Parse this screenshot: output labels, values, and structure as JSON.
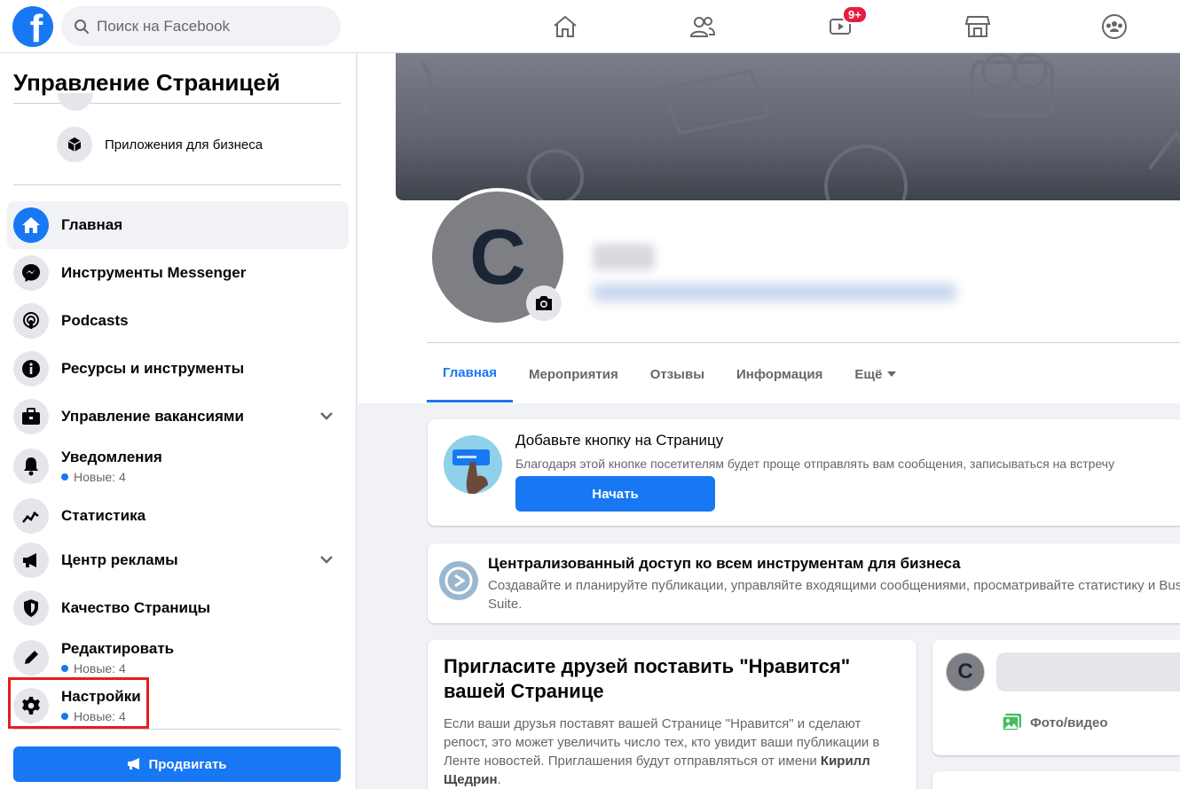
{
  "topbar": {
    "logo_letter": "f",
    "search_placeholder": "Поиск на Facebook",
    "nav": [
      {
        "name": "home-icon"
      },
      {
        "name": "friends-icon"
      },
      {
        "name": "watch-icon",
        "badge": "9+"
      },
      {
        "name": "marketplace-icon"
      },
      {
        "name": "groups-icon"
      }
    ]
  },
  "sidebar": {
    "title": "Управление Страницей",
    "apps_label": "Приложения для бизнеса",
    "items": [
      {
        "label": "Главная",
        "icon": "home-icon"
      },
      {
        "label": "Инструменты Messenger",
        "icon": "messenger-icon"
      },
      {
        "label": "Podcasts",
        "icon": "podcasts-icon"
      },
      {
        "label": "Ресурсы и инструменты",
        "icon": "info-icon"
      },
      {
        "label": "Управление вакансиями",
        "icon": "briefcase-icon"
      },
      {
        "label": "Уведомления",
        "icon": "bell-icon",
        "new": "Новые: 4"
      },
      {
        "label": "Статистика",
        "icon": "chart-icon"
      },
      {
        "label": "Центр рекламы",
        "icon": "megaphone-icon"
      },
      {
        "label": "Качество Страницы",
        "icon": "shield-icon"
      },
      {
        "label": "Редактировать",
        "icon": "pencil-icon",
        "new": "Новые: 4"
      },
      {
        "label": "Настройки",
        "icon": "gear-icon",
        "new": "Новые: 4"
      }
    ],
    "promote_label": "Продвигать"
  },
  "profile": {
    "avatar_letter": "C",
    "tabs": [
      "Главная",
      "Мероприятия",
      "Отзывы",
      "Информация",
      "Ещё"
    ]
  },
  "cta_card": {
    "title": "Добавьте кнопку на Страницу",
    "text": "Благодаря этой кнопке посетителям будет проще отправлять вам сообщения, записываться на встречу",
    "button": "Начать"
  },
  "business_card": {
    "title": "Централизованный доступ ко всем инструментам для бизнеса",
    "text": "Создавайте и планируйте публикации, управляйте входящими сообщениями, просматривайте статистику и Business Suite."
  },
  "invite_card": {
    "title": "Пригласите друзей поставить \"Нравится\" вашей Странице",
    "text": "Если ваши друзья поставят вашей Странице \"Нравится\" и сделают репост, это может увеличить число тех, кто увидит ваши публикации в Ленте новостей. Приглашения будут отправляться от имени",
    "name": "Кирилл Щедрин",
    "tail": "."
  },
  "composer": {
    "avatar_letter": "C",
    "photo_label": "Фото/видео"
  },
  "colors": {
    "brand": "#1877f2",
    "highlight": "#e41e1e",
    "badge": "#e41e3f"
  }
}
